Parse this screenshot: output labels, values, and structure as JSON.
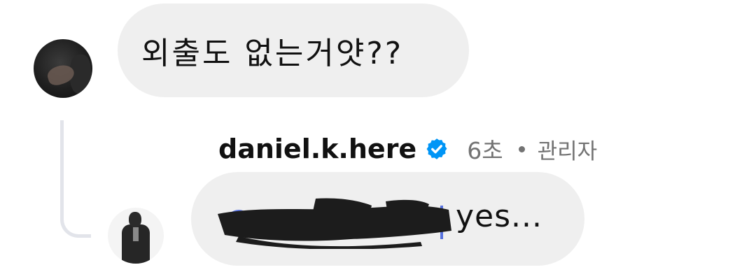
{
  "comment": {
    "text": "외출도 없는거얏??"
  },
  "reply": {
    "username": "daniel.k.here",
    "time": "6초",
    "role": "관리자",
    "text": "yes...",
    "verified_color": "#0095f6",
    "mention_color": "#3b5bdb",
    "redaction_color": "#1c1c1c"
  },
  "colors": {
    "bubble": "#efefef",
    "thread_line": "#e2e4ea",
    "meta": "#737373"
  }
}
